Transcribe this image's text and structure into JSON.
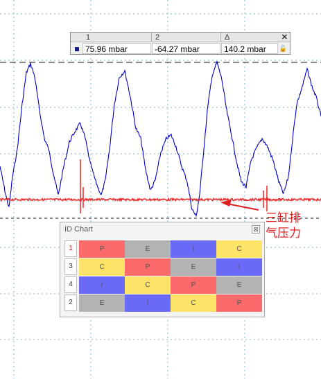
{
  "colors": {
    "pressure_trace": "#0000c8",
    "event_trace": "#ee2222",
    "grid": "#7fb8c8",
    "annotation": "#e02020",
    "P": "#fa6a6a",
    "C": "#fde468",
    "E": "#b3b3b3",
    "I": "#6a6af8"
  },
  "cursor_panel": {
    "headers": [
      "1",
      "2",
      "Δ"
    ],
    "values": [
      "75.96 mbar",
      "-64.27 mbar",
      "140.2 mbar"
    ],
    "close_glyph": "✕",
    "lock_glyph": "🔓"
  },
  "id_chart": {
    "title": "ID Chart",
    "close_glyph": "⊠",
    "rows": [
      {
        "label": "1",
        "label_color": "#d02020",
        "cells": [
          "P",
          "E",
          "I",
          "C"
        ]
      },
      {
        "label": "3",
        "label_color": "#333333",
        "cells": [
          "C",
          "P",
          "E",
          "I"
        ]
      },
      {
        "label": "4",
        "label_color": "#333333",
        "cells": [
          "I",
          "C",
          "P",
          "E"
        ]
      },
      {
        "label": "2",
        "label_color": "#333333",
        "cells": [
          "E",
          "I",
          "C",
          "P"
        ]
      }
    ]
  },
  "annotation": {
    "line1": "三缸排",
    "line2": "气压力"
  }
}
